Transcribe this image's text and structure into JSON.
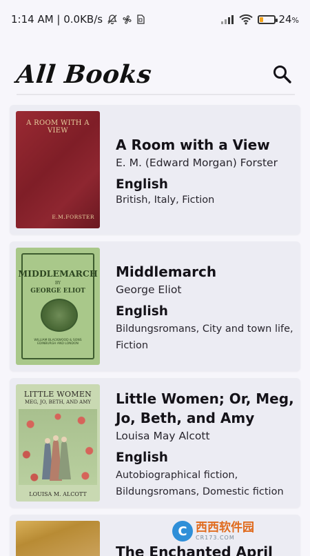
{
  "status_bar": {
    "time_speed": "1:14 AM | 0.0KB/s",
    "battery_percent": "24",
    "battery_pct_symbol": "%",
    "battery_level": 0.24,
    "battery_color": "#f2a21a",
    "icons": [
      "mute-bell-icon",
      "fan-icon",
      "sim-icon",
      "signal-icon",
      "wifi-icon",
      "battery-icon"
    ]
  },
  "header": {
    "title": "All Books",
    "search_icon": "search-icon"
  },
  "books": [
    {
      "title": "A Room with a View",
      "author": "E. M. (Edward Morgan) Forster",
      "language": "English",
      "subjects": "British, Italy, Fiction",
      "cover": {
        "title_text": "A ROOM WITH A VIEW",
        "author_text": "E.M.FORSTER",
        "color": "#8e2630"
      }
    },
    {
      "title": "Middlemarch",
      "author": "George Eliot",
      "language": "English",
      "subjects_line1": "Bildungsromans, City and town life,",
      "subjects_line2": "Fiction",
      "cover": {
        "title_text": "MIDDLEMARCH",
        "by_text": "BY",
        "author_text": "GEORGE ELIOT",
        "publisher_line1": "WILLIAM BLACKWOOD & SONS",
        "publisher_line2": "EDINBURGH AND LONDON",
        "color": "#a9c88a"
      }
    },
    {
      "title_line1": "Little Women; Or, Meg,",
      "title_line2": "Jo, Beth, and Amy",
      "author": "Louisa May Alcott",
      "language": "English",
      "subjects_line1": "Autobiographical fiction,",
      "subjects_line2": "Bildungsromans, Domestic fiction",
      "cover": {
        "title_text": "LITTLE WOMEN",
        "subtitle_text": "MEG, JO, BETH, AND AMY",
        "author_text": "LOUISA M. ALCOTT",
        "color": "#c9d9b2"
      }
    },
    {
      "title": "The Enchanted April",
      "cover": {
        "color": "#d9b15a"
      }
    }
  ],
  "watermark": {
    "badge": "C",
    "main": "西西软件园",
    "sub": "CR173.COM"
  }
}
